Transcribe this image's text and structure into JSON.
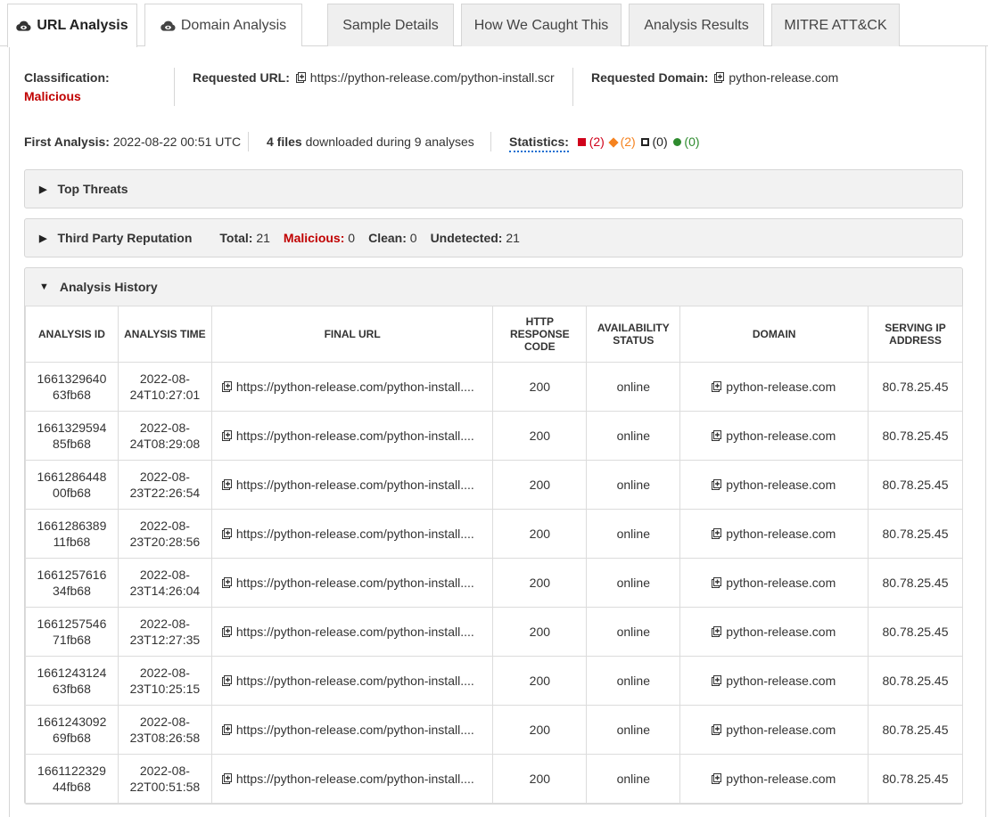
{
  "tabs": [
    {
      "label": "URL Analysis",
      "icon": "cloud-eye-icon"
    },
    {
      "label": "Domain Analysis",
      "icon": "cloud-eye-icon"
    },
    {
      "label": "Sample Details"
    },
    {
      "label": "How We Caught This"
    },
    {
      "label": "Analysis Results"
    },
    {
      "label": "MITRE ATT&CK"
    }
  ],
  "summary": {
    "classification_label": "Classification:",
    "classification_value": "Malicious",
    "requested_url_label": "Requested URL:",
    "requested_url_value": "https://python-release.com/python-install.scr",
    "requested_domain_label": "Requested Domain:",
    "requested_domain_value": "python-release.com",
    "first_analysis_label": "First Analysis:",
    "first_analysis_value": "2022-08-22 00:51 UTC",
    "files_count": "4 files",
    "files_text": "downloaded during 9 analyses",
    "statistics_label": "Statistics:",
    "stats": [
      {
        "value": "(2)",
        "color": "#d0021b",
        "shape": "square"
      },
      {
        "value": "(2)",
        "color": "#f5821f",
        "shape": "diamond"
      },
      {
        "value": "(0)",
        "color": "#222222",
        "shape": "hollow-square"
      },
      {
        "value": "(0)",
        "color": "#2e8b2e",
        "shape": "circle"
      }
    ]
  },
  "panels": {
    "top_threats": "Top Threats",
    "third_party": {
      "title": "Third Party Reputation",
      "total_label": "Total:",
      "total_value": "21",
      "malicious_label": "Malicious:",
      "malicious_value": "0",
      "clean_label": "Clean:",
      "clean_value": "0",
      "undetected_label": "Undetected:",
      "undetected_value": "21"
    },
    "analysis_history": "Analysis History"
  },
  "table": {
    "headers": [
      "ANALYSIS ID",
      "ANALYSIS TIME",
      "FINAL URL",
      "HTTP RESPONSE CODE",
      "AVAILABILITY STATUS",
      "DOMAIN",
      "SERVING IP ADDRESS"
    ],
    "rows": [
      {
        "id1": "1661329640",
        "id2": "63fb68",
        "t1": "2022-08-",
        "t2": "24T10:27:01",
        "url": "https://python-release.com/python-install....",
        "code": "200",
        "status": "online",
        "domain": "python-release.com",
        "ip": "80.78.25.45"
      },
      {
        "id1": "1661329594",
        "id2": "85fb68",
        "t1": "2022-08-",
        "t2": "24T08:29:08",
        "url": "https://python-release.com/python-install....",
        "code": "200",
        "status": "online",
        "domain": "python-release.com",
        "ip": "80.78.25.45"
      },
      {
        "id1": "1661286448",
        "id2": "00fb68",
        "t1": "2022-08-",
        "t2": "23T22:26:54",
        "url": "https://python-release.com/python-install....",
        "code": "200",
        "status": "online",
        "domain": "python-release.com",
        "ip": "80.78.25.45"
      },
      {
        "id1": "1661286389",
        "id2": "11fb68",
        "t1": "2022-08-",
        "t2": "23T20:28:56",
        "url": "https://python-release.com/python-install....",
        "code": "200",
        "status": "online",
        "domain": "python-release.com",
        "ip": "80.78.25.45"
      },
      {
        "id1": "1661257616",
        "id2": "34fb68",
        "t1": "2022-08-",
        "t2": "23T14:26:04",
        "url": "https://python-release.com/python-install....",
        "code": "200",
        "status": "online",
        "domain": "python-release.com",
        "ip": "80.78.25.45"
      },
      {
        "id1": "1661257546",
        "id2": "71fb68",
        "t1": "2022-08-",
        "t2": "23T12:27:35",
        "url": "https://python-release.com/python-install....",
        "code": "200",
        "status": "online",
        "domain": "python-release.com",
        "ip": "80.78.25.45"
      },
      {
        "id1": "1661243124",
        "id2": "63fb68",
        "t1": "2022-08-",
        "t2": "23T10:25:15",
        "url": "https://python-release.com/python-install....",
        "code": "200",
        "status": "online",
        "domain": "python-release.com",
        "ip": "80.78.25.45"
      },
      {
        "id1": "1661243092",
        "id2": "69fb68",
        "t1": "2022-08-",
        "t2": "23T08:26:58",
        "url": "https://python-release.com/python-install....",
        "code": "200",
        "status": "online",
        "domain": "python-release.com",
        "ip": "80.78.25.45"
      },
      {
        "id1": "1661122329",
        "id2": "44fb68",
        "t1": "2022-08-",
        "t2": "22T00:51:58",
        "url": "https://python-release.com/python-install....",
        "code": "200",
        "status": "online",
        "domain": "python-release.com",
        "ip": "80.78.25.45"
      }
    ]
  }
}
